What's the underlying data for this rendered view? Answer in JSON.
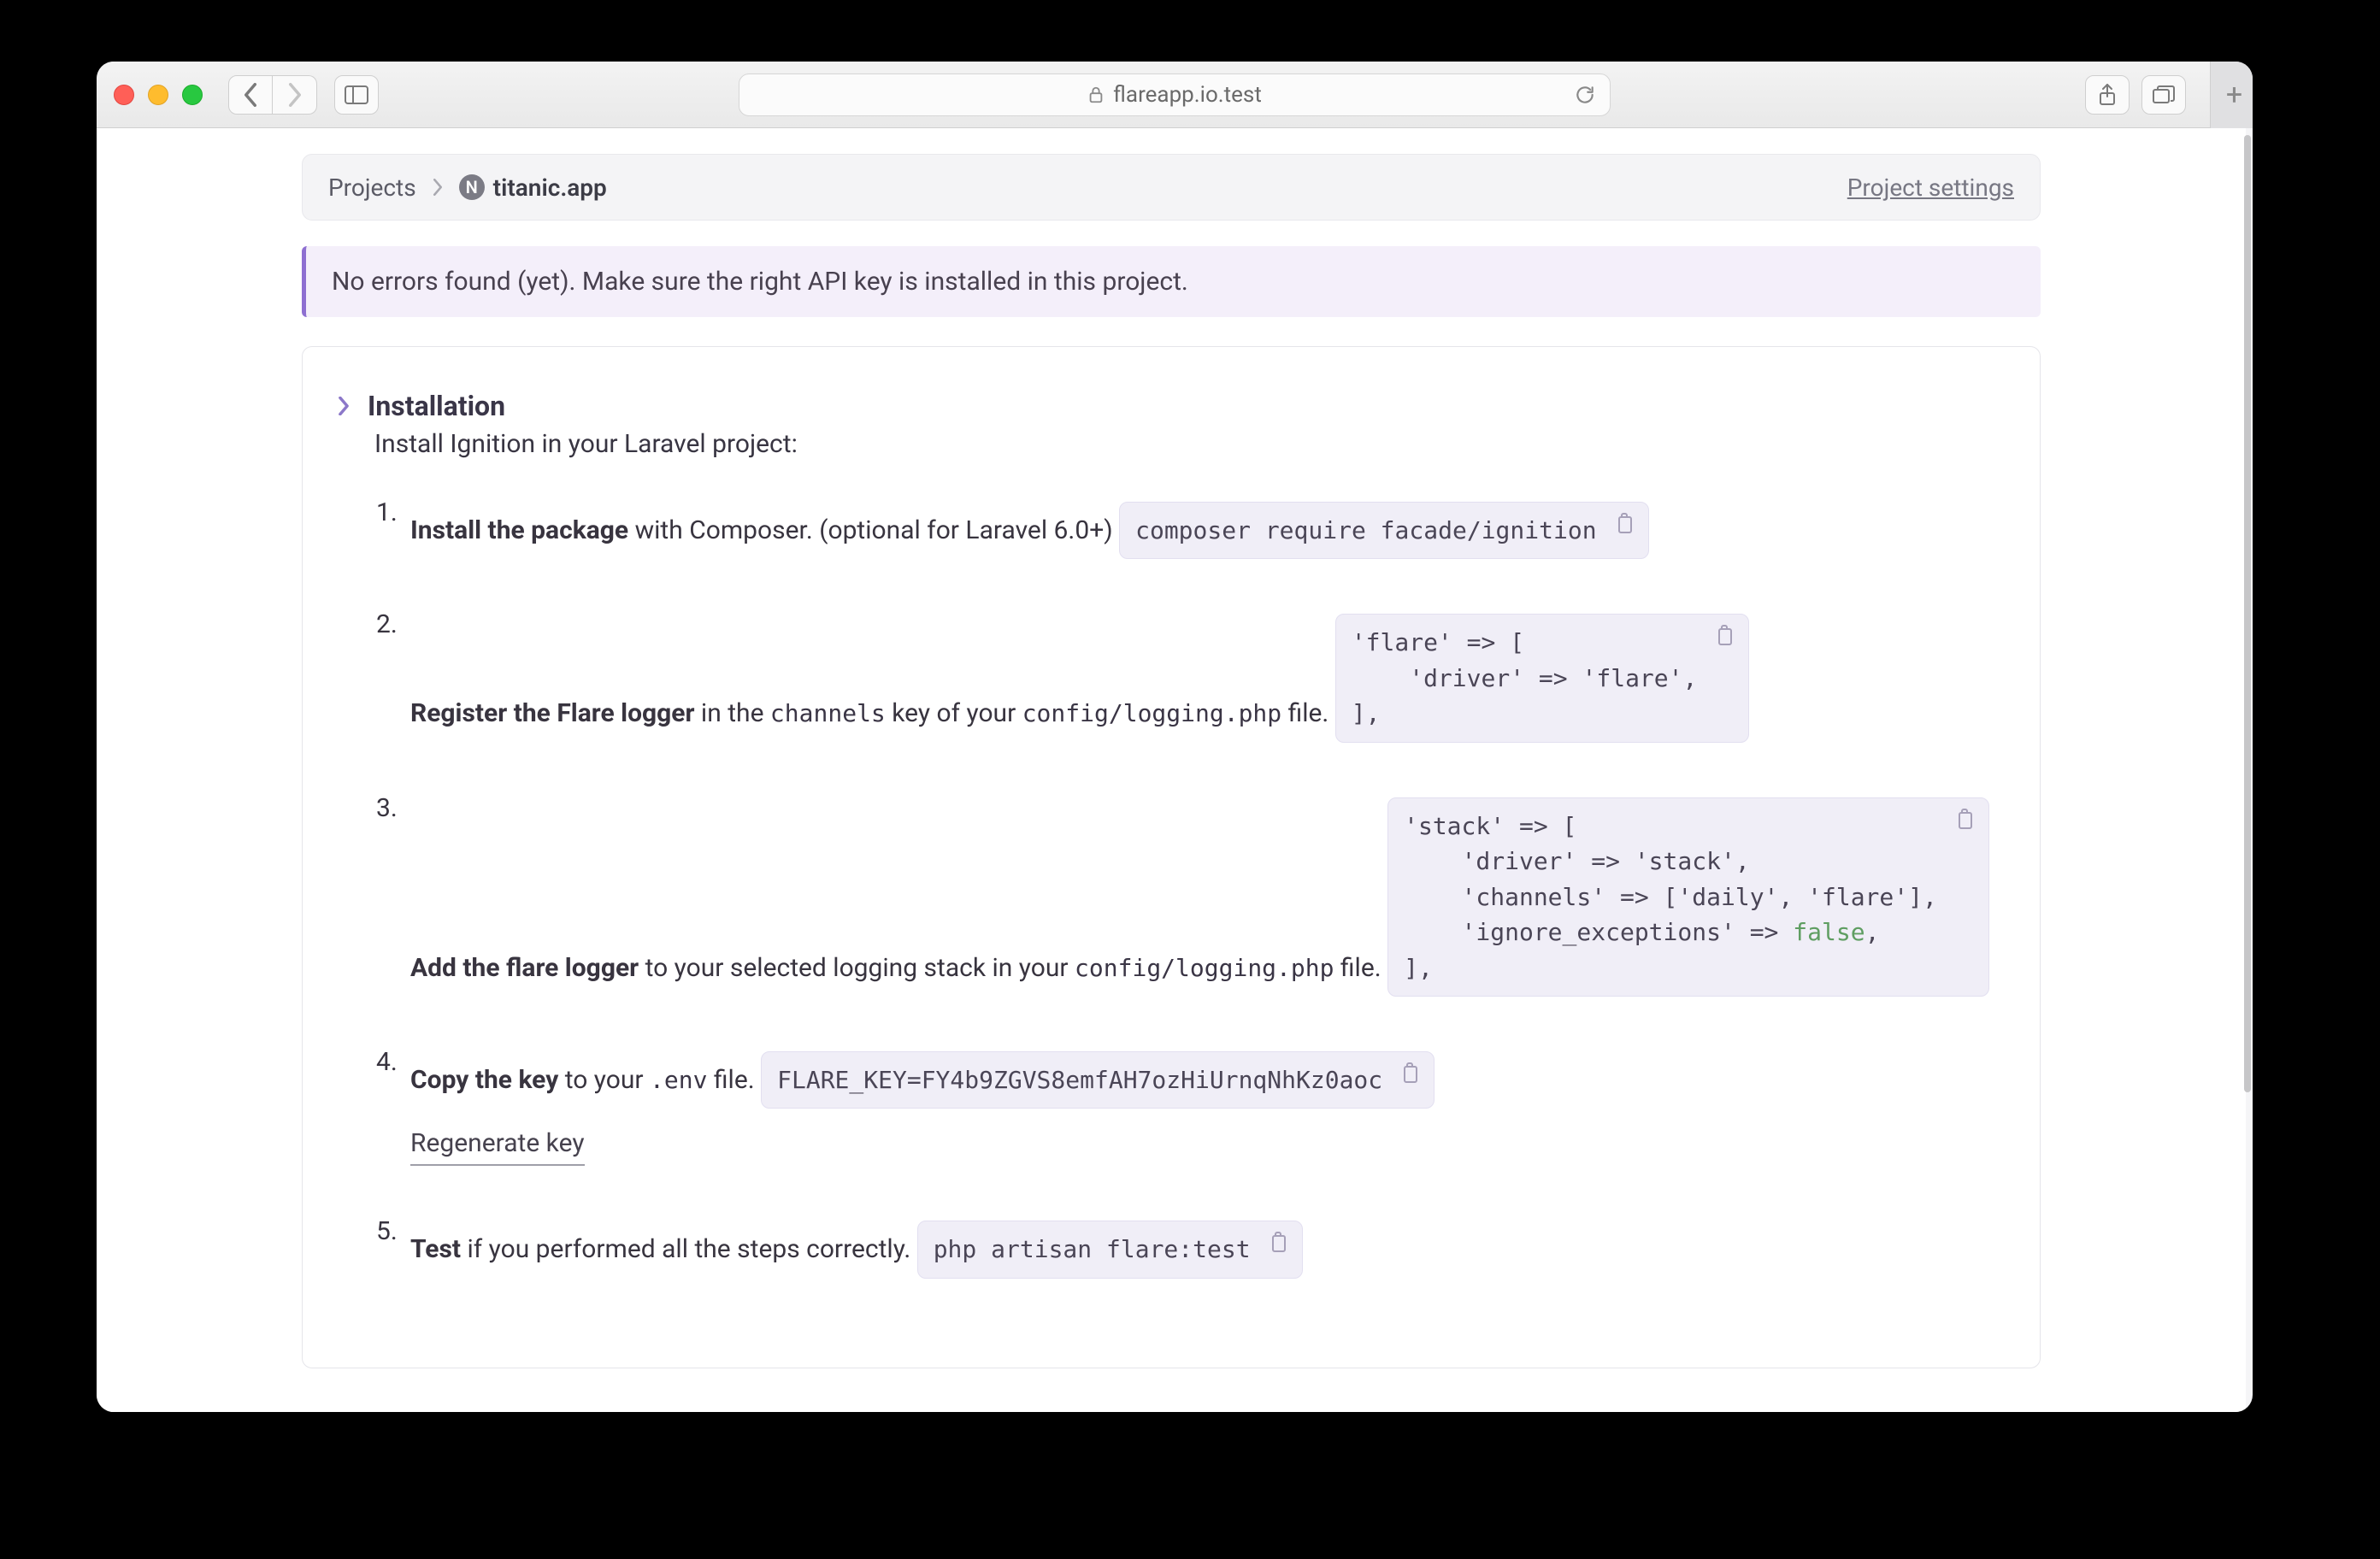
{
  "browser": {
    "url": "flareapp.io.test"
  },
  "breadcrumb": {
    "root": "Projects",
    "project_badge": "N",
    "project_name": "titanic.app",
    "settings_link": "Project settings"
  },
  "alert": {
    "message": "No errors found (yet). Make sure the right API key is installed in this project."
  },
  "installation": {
    "heading": "Installation",
    "subtitle": "Install Ignition in your Laravel project:",
    "steps": [
      {
        "bold": "Install the package",
        "rest": " with Composer. (optional for Laravel 6.0+)",
        "code": "composer require facade/ignition"
      },
      {
        "bold": "Register the Flare logger",
        "rest_pre": " in the ",
        "inline1": "channels",
        "rest_mid": " key of your ",
        "inline2": "config/logging.php",
        "rest_post": " file.",
        "code": "'flare' => [\n    'driver' => 'flare',\n],"
      },
      {
        "bold": "Add the flare logger",
        "rest_pre": " to your selected logging stack in your ",
        "inline1": "config/logging.php",
        "rest_post": " file.",
        "code": "'stack' => [\n    'driver' => 'stack',\n    'channels' => ['daily', 'flare'],\n    'ignore_exceptions' => false,\n],"
      },
      {
        "bold": "Copy the key",
        "rest_pre": " to your ",
        "inline1": ".env",
        "rest_post": " file.",
        "code": "FLARE_KEY=FY4b9ZGVS8emfAH7ozHiUrnqNhKz0aoc",
        "regenerate": "Regenerate key"
      },
      {
        "bold": "Test",
        "rest": " if you performed all the steps correctly.",
        "code": "php artisan flare:test"
      }
    ]
  }
}
